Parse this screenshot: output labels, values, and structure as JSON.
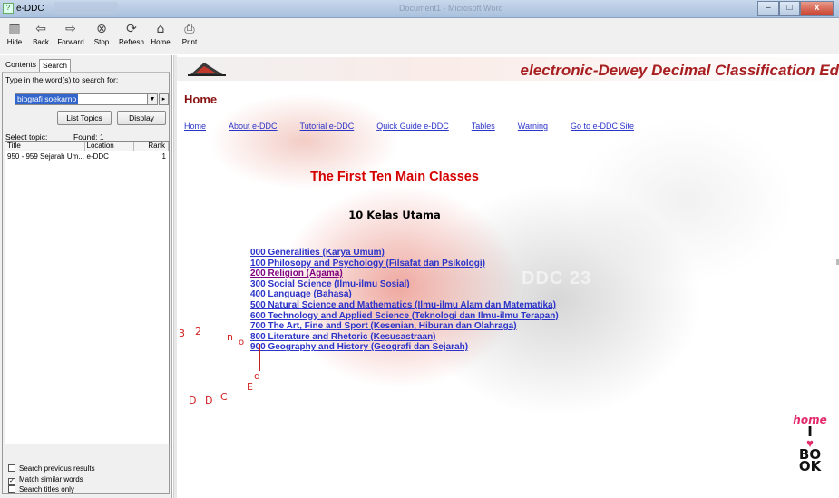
{
  "window": {
    "title": "e-DDC",
    "doc_title": "Document1 - Microsoft Word",
    "controls": [
      "–",
      "□",
      "x"
    ]
  },
  "toolbar": {
    "buttons": [
      {
        "label": "Hide",
        "icon": "hide-icon"
      },
      {
        "label": "Back",
        "icon": "back-arrow-icon"
      },
      {
        "label": "Forward",
        "icon": "forward-arrow-icon"
      },
      {
        "label": "Stop",
        "icon": "stop-icon"
      },
      {
        "label": "Refresh",
        "icon": "refresh-icon"
      },
      {
        "label": "Home",
        "icon": "home-icon"
      },
      {
        "label": "Print",
        "icon": "print-icon"
      }
    ]
  },
  "sidebar": {
    "tabs": [
      "Contents",
      "Search"
    ],
    "active_tab": "Search",
    "prompt": "Type in the word(s) to search for:",
    "search_value": "biografi soekarno",
    "list_topics_label": "List Topics",
    "display_label": "Display",
    "select_topic_label": "Select topic:",
    "found_label": "Found: 1",
    "columns": [
      "Title",
      "Location",
      "Rank"
    ],
    "rows": [
      {
        "title": "950 - 959 Sejarah Um...",
        "location": "e-DDC",
        "rank": "1"
      }
    ],
    "options": [
      {
        "label": "Search previous results",
        "checked": false
      },
      {
        "label": "Match similar words",
        "checked": true
      },
      {
        "label": "Search titles only",
        "checked": false
      }
    ]
  },
  "content": {
    "brand": "electronic-Dewey Decimal Classification Ed",
    "heading": "Home",
    "nav": [
      "Home",
      "About e-DDC",
      "Tutorial e-DDC",
      "Quick Guide e-DDC",
      "Tables",
      "Warning",
      "Go to e-DDC Site"
    ],
    "main_title": "The First Ten Main Classes",
    "sub_title": "10 Kelas Utama",
    "classes": [
      "000 Generalities (Karya Umum)",
      "100 Philosopy and Psychology (Filsafat dan Psikologi)",
      "200 Religion (Agama)",
      "300 Social Science (Ilmu-ilmu Sosial)",
      "400 Language (Bahasa)",
      "500 Natural Science and Mathematics (Ilmu-ilmu Alam dan Matematika)",
      "600 Technology and Applied Science (Teknologi dan Ilmu-ilmu Terapan)",
      "700 The Art, Fine and Sport (Kesenian, Hiburan dan Olahraga)",
      "800 Literature and Rhetoric (Kesusastraan)",
      "900 Geography and History (Geografi dan Sejarah)"
    ],
    "visited_index": 2,
    "stray_chars": [
      "3",
      "2",
      "n",
      "o",
      "d",
      "E",
      "D",
      "D",
      "C"
    ],
    "ghost_text": "DDC 23",
    "badge": {
      "top": "home",
      "lines": [
        "I",
        "BO",
        "OK"
      ]
    }
  },
  "colors": {
    "brand": "#a81f22",
    "heading": "#8a1414",
    "link": "#2b33c8",
    "visited": "#800080",
    "title_red": "#d40000"
  }
}
